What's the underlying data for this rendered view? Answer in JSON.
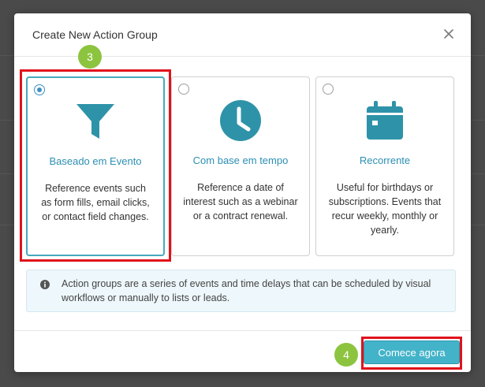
{
  "dialog": {
    "title": "Create New Action Group",
    "close_glyph": "×"
  },
  "cards": [
    {
      "icon": "funnel-icon",
      "title": "Baseado em Evento",
      "description": "Reference events such as form fills, email clicks, or contact field changes.",
      "selected": true
    },
    {
      "icon": "clock-icon",
      "title": "Com base em tempo",
      "description": "Reference a date of interest such as a webinar or a contract renewal.",
      "selected": false
    },
    {
      "icon": "calendar-icon",
      "title": "Recorrente",
      "description": "Useful for birthdays or subscriptions. Events that recur weekly, monthly or yearly.",
      "selected": false
    }
  ],
  "info": {
    "icon": "info-icon",
    "text": "Action groups are a series of events and time delays that can be scheduled by visual workflows or manually to lists or leads."
  },
  "footer": {
    "primary_label": "Comece agora"
  },
  "annotations": {
    "step_3": "3",
    "step_4": "4",
    "badge_color": "#8cc43f",
    "highlight_color": "#e0121c"
  },
  "colors": {
    "accent": "#47a9bd",
    "icon_teal": "#2e93a8",
    "title_link": "#2d8fb3",
    "button": "#43b3c9"
  }
}
